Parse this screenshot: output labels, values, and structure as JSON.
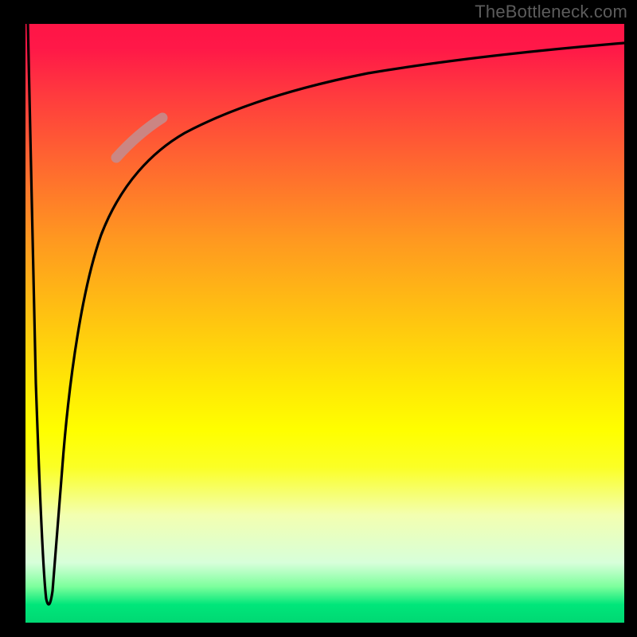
{
  "watermark": "TheBottleneck.com",
  "chart_data": {
    "type": "line",
    "title": "",
    "xlabel": "",
    "ylabel": "",
    "xlim": [
      0,
      100
    ],
    "ylim": [
      0,
      100
    ],
    "series": [
      {
        "name": "bottleneck-curve",
        "x": [
          0,
          2,
          3,
          4,
          5,
          6,
          8,
          10,
          12,
          15,
          18,
          22,
          28,
          35,
          45,
          55,
          70,
          85,
          100
        ],
        "y": [
          100,
          40,
          10,
          3,
          20,
          40,
          55,
          65,
          72,
          78,
          82,
          85,
          88,
          90,
          92,
          93.5,
          95,
          96,
          97
        ]
      },
      {
        "name": "highlight-segment",
        "x": [
          15,
          22
        ],
        "y": [
          78,
          85
        ]
      }
    ],
    "annotations": []
  },
  "colors": {
    "curve": "#000000",
    "highlight": "#c78a8a",
    "gradient_top": "#ff1546",
    "gradient_mid": "#ffff00",
    "gradient_bottom": "#00d873",
    "frame": "#000000",
    "watermark": "#5c5c5c"
  }
}
